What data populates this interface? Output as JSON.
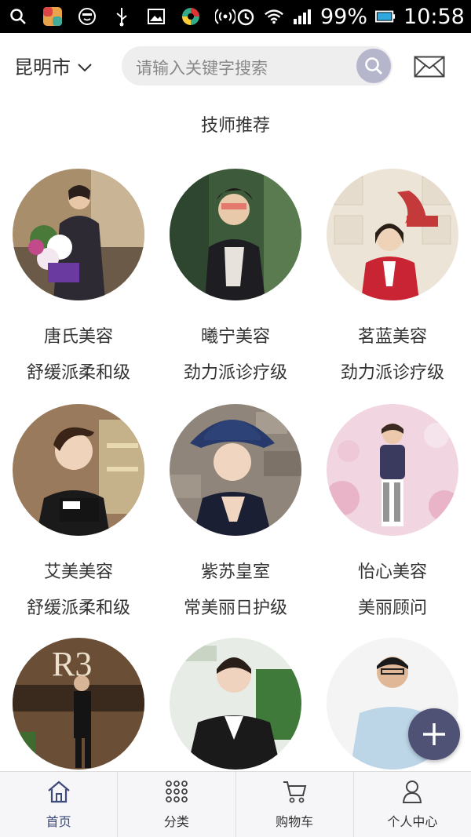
{
  "status_bar": {
    "battery_percent": "99%",
    "time": "10:58",
    "icons": [
      "search-icon",
      "app-icon",
      "emoji-icon",
      "usb-icon",
      "image-icon",
      "browser-icon",
      "hotspot-icon",
      "alarm-icon",
      "wifi-icon",
      "signal-icon",
      "battery-icon"
    ]
  },
  "header": {
    "city": "昆明市",
    "search_placeholder": "请输入关键字搜索"
  },
  "section": {
    "title": "技师推荐"
  },
  "technicians": [
    {
      "name": "唐氏美容",
      "level": "舒缓派柔和级"
    },
    {
      "name": "曦宁美容",
      "level": "劲力派诊疗级"
    },
    {
      "name": "茗蓝美容",
      "level": "劲力派诊疗级"
    },
    {
      "name": "艾美美容",
      "level": "舒缓派柔和级"
    },
    {
      "name": "紫苏皇室",
      "level": "常美丽日护级"
    },
    {
      "name": "怡心美容",
      "level": "美丽顾问"
    },
    {
      "name": "",
      "level": ""
    },
    {
      "name": "",
      "level": ""
    },
    {
      "name": "",
      "level": ""
    }
  ],
  "tabbar": {
    "tabs": [
      {
        "label": "首页",
        "icon": "home-icon"
      },
      {
        "label": "分类",
        "icon": "grid-icon"
      },
      {
        "label": "购物车",
        "icon": "cart-icon"
      },
      {
        "label": "个人中心",
        "icon": "person-icon"
      }
    ]
  },
  "colors": {
    "accent": "#3d4a7a",
    "fab": "#4f5275",
    "search_bg": "#eeeeee"
  }
}
